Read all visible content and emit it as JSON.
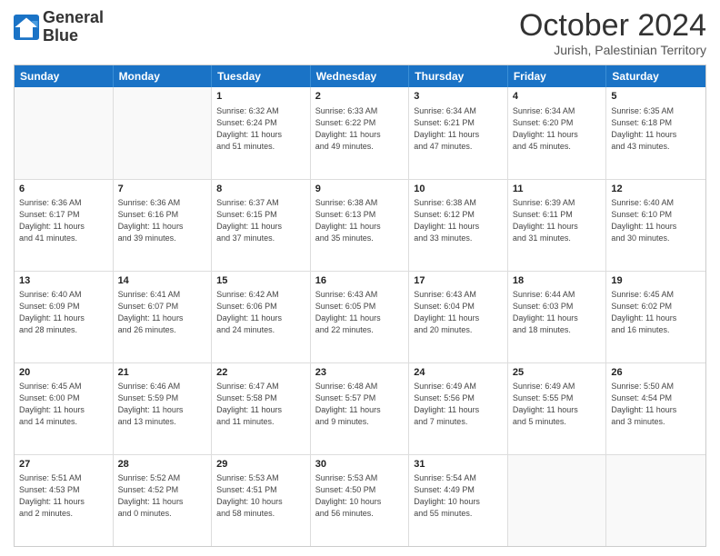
{
  "logo": {
    "line1": "General",
    "line2": "Blue"
  },
  "title": "October 2024",
  "location": "Jurish, Palestinian Territory",
  "header_days": [
    "Sunday",
    "Monday",
    "Tuesday",
    "Wednesday",
    "Thursday",
    "Friday",
    "Saturday"
  ],
  "rows": [
    [
      {
        "day": "",
        "detail": ""
      },
      {
        "day": "",
        "detail": ""
      },
      {
        "day": "1",
        "detail": "Sunrise: 6:32 AM\nSunset: 6:24 PM\nDaylight: 11 hours\nand 51 minutes."
      },
      {
        "day": "2",
        "detail": "Sunrise: 6:33 AM\nSunset: 6:22 PM\nDaylight: 11 hours\nand 49 minutes."
      },
      {
        "day": "3",
        "detail": "Sunrise: 6:34 AM\nSunset: 6:21 PM\nDaylight: 11 hours\nand 47 minutes."
      },
      {
        "day": "4",
        "detail": "Sunrise: 6:34 AM\nSunset: 6:20 PM\nDaylight: 11 hours\nand 45 minutes."
      },
      {
        "day": "5",
        "detail": "Sunrise: 6:35 AM\nSunset: 6:18 PM\nDaylight: 11 hours\nand 43 minutes."
      }
    ],
    [
      {
        "day": "6",
        "detail": "Sunrise: 6:36 AM\nSunset: 6:17 PM\nDaylight: 11 hours\nand 41 minutes."
      },
      {
        "day": "7",
        "detail": "Sunrise: 6:36 AM\nSunset: 6:16 PM\nDaylight: 11 hours\nand 39 minutes."
      },
      {
        "day": "8",
        "detail": "Sunrise: 6:37 AM\nSunset: 6:15 PM\nDaylight: 11 hours\nand 37 minutes."
      },
      {
        "day": "9",
        "detail": "Sunrise: 6:38 AM\nSunset: 6:13 PM\nDaylight: 11 hours\nand 35 minutes."
      },
      {
        "day": "10",
        "detail": "Sunrise: 6:38 AM\nSunset: 6:12 PM\nDaylight: 11 hours\nand 33 minutes."
      },
      {
        "day": "11",
        "detail": "Sunrise: 6:39 AM\nSunset: 6:11 PM\nDaylight: 11 hours\nand 31 minutes."
      },
      {
        "day": "12",
        "detail": "Sunrise: 6:40 AM\nSunset: 6:10 PM\nDaylight: 11 hours\nand 30 minutes."
      }
    ],
    [
      {
        "day": "13",
        "detail": "Sunrise: 6:40 AM\nSunset: 6:09 PM\nDaylight: 11 hours\nand 28 minutes."
      },
      {
        "day": "14",
        "detail": "Sunrise: 6:41 AM\nSunset: 6:07 PM\nDaylight: 11 hours\nand 26 minutes."
      },
      {
        "day": "15",
        "detail": "Sunrise: 6:42 AM\nSunset: 6:06 PM\nDaylight: 11 hours\nand 24 minutes."
      },
      {
        "day": "16",
        "detail": "Sunrise: 6:43 AM\nSunset: 6:05 PM\nDaylight: 11 hours\nand 22 minutes."
      },
      {
        "day": "17",
        "detail": "Sunrise: 6:43 AM\nSunset: 6:04 PM\nDaylight: 11 hours\nand 20 minutes."
      },
      {
        "day": "18",
        "detail": "Sunrise: 6:44 AM\nSunset: 6:03 PM\nDaylight: 11 hours\nand 18 minutes."
      },
      {
        "day": "19",
        "detail": "Sunrise: 6:45 AM\nSunset: 6:02 PM\nDaylight: 11 hours\nand 16 minutes."
      }
    ],
    [
      {
        "day": "20",
        "detail": "Sunrise: 6:45 AM\nSunset: 6:00 PM\nDaylight: 11 hours\nand 14 minutes."
      },
      {
        "day": "21",
        "detail": "Sunrise: 6:46 AM\nSunset: 5:59 PM\nDaylight: 11 hours\nand 13 minutes."
      },
      {
        "day": "22",
        "detail": "Sunrise: 6:47 AM\nSunset: 5:58 PM\nDaylight: 11 hours\nand 11 minutes."
      },
      {
        "day": "23",
        "detail": "Sunrise: 6:48 AM\nSunset: 5:57 PM\nDaylight: 11 hours\nand 9 minutes."
      },
      {
        "day": "24",
        "detail": "Sunrise: 6:49 AM\nSunset: 5:56 PM\nDaylight: 11 hours\nand 7 minutes."
      },
      {
        "day": "25",
        "detail": "Sunrise: 6:49 AM\nSunset: 5:55 PM\nDaylight: 11 hours\nand 5 minutes."
      },
      {
        "day": "26",
        "detail": "Sunrise: 5:50 AM\nSunset: 4:54 PM\nDaylight: 11 hours\nand 3 minutes."
      }
    ],
    [
      {
        "day": "27",
        "detail": "Sunrise: 5:51 AM\nSunset: 4:53 PM\nDaylight: 11 hours\nand 2 minutes."
      },
      {
        "day": "28",
        "detail": "Sunrise: 5:52 AM\nSunset: 4:52 PM\nDaylight: 11 hours\nand 0 minutes."
      },
      {
        "day": "29",
        "detail": "Sunrise: 5:53 AM\nSunset: 4:51 PM\nDaylight: 10 hours\nand 58 minutes."
      },
      {
        "day": "30",
        "detail": "Sunrise: 5:53 AM\nSunset: 4:50 PM\nDaylight: 10 hours\nand 56 minutes."
      },
      {
        "day": "31",
        "detail": "Sunrise: 5:54 AM\nSunset: 4:49 PM\nDaylight: 10 hours\nand 55 minutes."
      },
      {
        "day": "",
        "detail": ""
      },
      {
        "day": "",
        "detail": ""
      }
    ]
  ]
}
